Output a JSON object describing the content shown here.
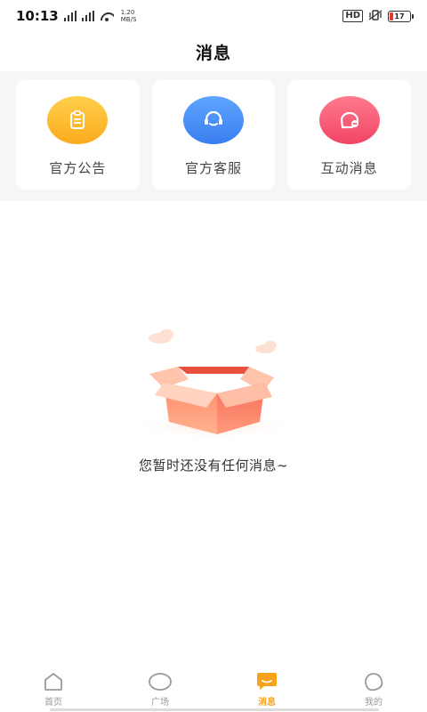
{
  "status_bar": {
    "time": "10:13",
    "speed_value": "1.20",
    "speed_unit": "MB/S",
    "hd_label": "HD",
    "battery_level": "17"
  },
  "header": {
    "title": "消息"
  },
  "categories": [
    {
      "label": "官方公告",
      "icon": "clipboard-icon",
      "color": "#fbab1f"
    },
    {
      "label": "官方客服",
      "icon": "headset-icon",
      "color": "#3a7df0"
    },
    {
      "label": "互动消息",
      "icon": "chat-bubble-icon",
      "color": "#f04564"
    }
  ],
  "empty_state": {
    "text": "您暂时还没有任何消息~"
  },
  "tabs": [
    {
      "label": "首页",
      "icon": "home-icon",
      "active": false
    },
    {
      "label": "广场",
      "icon": "circle-icon",
      "active": false
    },
    {
      "label": "消息",
      "icon": "message-icon",
      "active": true
    },
    {
      "label": "我的",
      "icon": "profile-icon",
      "active": false
    }
  ],
  "colors": {
    "accent": "#f7a21d",
    "inactive": "#999999",
    "section_bg": "#f6f6f7"
  }
}
